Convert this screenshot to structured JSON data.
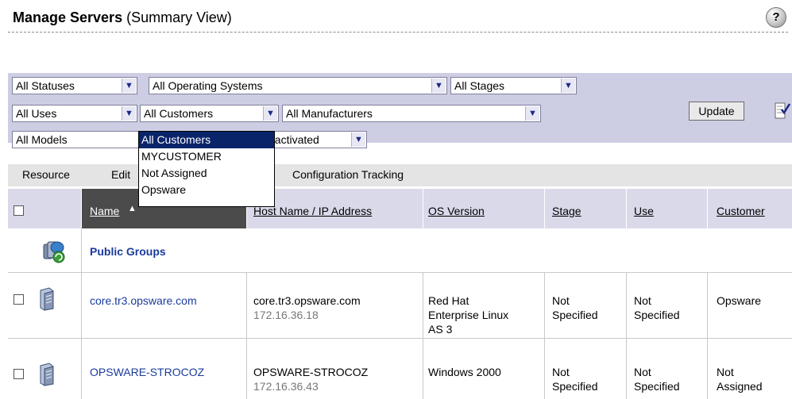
{
  "header": {
    "title_bold": "Manage Servers",
    "title_rest": "(Summary View)",
    "help_label": "?"
  },
  "filters": {
    "status": "All Statuses",
    "os": "All Operating Systems",
    "stage": "All Stages",
    "use": "All Uses",
    "customer": "All Customers",
    "manufacturer": "All Manufacturers",
    "model": "All Models",
    "deactivated": "eactivated",
    "arrow": "▼",
    "update_label": "Update"
  },
  "customer_dropdown": {
    "options": [
      "All Customers",
      "MYCUSTOMER",
      "Not Assigned",
      "Opsware"
    ],
    "selected": "All Customers"
  },
  "toolbar": {
    "resource": "Resource",
    "edit": "Edit",
    "config_tracking": "Configuration Tracking"
  },
  "columns": {
    "name": "Name",
    "host": "Host Name",
    "separator": " / ",
    "ip": "IP Address",
    "os": "OS Version",
    "stage": "Stage",
    "use": "Use",
    "customer": "Customer",
    "sort_indicator": "▲"
  },
  "public_groups": {
    "label": "Public Groups"
  },
  "servers": [
    {
      "name": "core.tr3.opsware.com",
      "host": "core.tr3.opsware.com",
      "ip": "172.16.36.18",
      "os": [
        "Red Hat",
        "Enterprise Linux",
        "AS 3"
      ],
      "stage": [
        "Not",
        "Specified"
      ],
      "use": [
        "Not",
        "Specified"
      ],
      "customer": [
        "Opsware"
      ]
    },
    {
      "name": "OPSWARE-STROCOZ",
      "host": "OPSWARE-STROCOZ",
      "ip": "172.16.36.43",
      "os": [
        "Windows 2000"
      ],
      "stage": [
        "Not",
        "Specified"
      ],
      "use": [
        "Not",
        "Specified"
      ],
      "customer": [
        "Not",
        "Assigned"
      ]
    }
  ],
  "colors": {
    "panel": "#cdcde3",
    "link": "#1a3b9c",
    "selected": "#0a246a",
    "header_sorted": "#4b4b4b"
  }
}
